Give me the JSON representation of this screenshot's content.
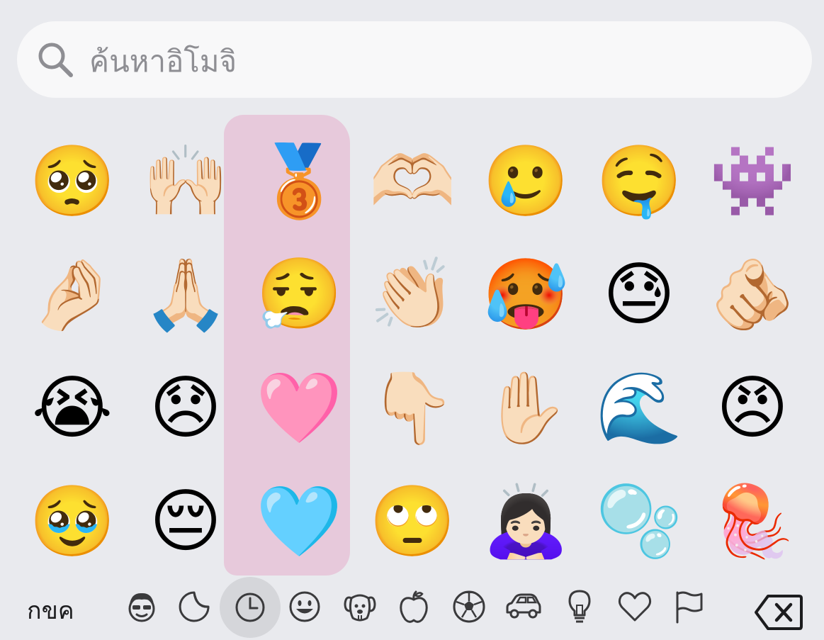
{
  "search": {
    "placeholder": "ค้นหาอิโมจิ"
  },
  "emoji_grid": {
    "highlight_color": "#e7c7d9",
    "rows": [
      [
        "🥺",
        "🙌🏻",
        "🥉",
        "🫶🏻",
        "🥲",
        "🤤",
        "👾"
      ],
      [
        "🤌🏻",
        "🙏🏻",
        "😮‍💨",
        "👏🏻",
        "🥵",
        "😓",
        "🫵🏻"
      ],
      [
        "😭",
        "😞",
        "🩷",
        "👇🏻",
        "✋🏻",
        "🌊",
        "😠"
      ],
      [
        "🥹",
        "😔",
        "🩵",
        "🙄",
        "🙇🏻‍♀️",
        "🫧",
        "🪼"
      ]
    ]
  },
  "bottom_bar": {
    "abc_label": "กขค",
    "categories": [
      {
        "name": "memoji-stickers",
        "icon": "memoji-icon"
      },
      {
        "name": "stickers",
        "icon": "sticker-icon"
      },
      {
        "name": "frequently-used",
        "icon": "clock-icon",
        "active": true
      },
      {
        "name": "smileys",
        "icon": "smiley-icon"
      },
      {
        "name": "animals",
        "icon": "dog-icon"
      },
      {
        "name": "food",
        "icon": "apple-icon"
      },
      {
        "name": "activity",
        "icon": "soccer-ball-icon"
      },
      {
        "name": "travel",
        "icon": "car-icon"
      },
      {
        "name": "objects",
        "icon": "lightbulb-icon"
      },
      {
        "name": "symbols",
        "icon": "heart-icon"
      },
      {
        "name": "flags",
        "icon": "flag-icon"
      }
    ],
    "delete_icon": "backspace-icon"
  }
}
